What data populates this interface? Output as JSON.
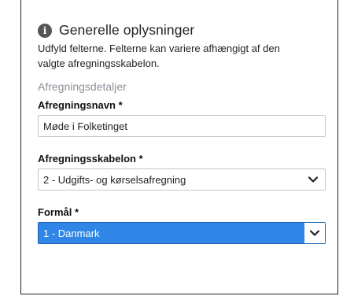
{
  "header": {
    "title": "Generelle oplysninger",
    "description": "Udfyld felterne. Felterne kan variere afhængigt af den valgte afregningsskabelon."
  },
  "section": {
    "title": "Afregningsdetaljer"
  },
  "fields": {
    "name": {
      "label": "Afregningsnavn *",
      "value": "Møde i Folketinget"
    },
    "template": {
      "label": "Afregningsskabelon *",
      "value": "2 - Udgifts- og kørselsafregning"
    },
    "purpose": {
      "label": "Formål *",
      "value": "1 - Danmark"
    }
  },
  "colors": {
    "accent": "#2f86e6",
    "muted": "#8a8f98"
  }
}
